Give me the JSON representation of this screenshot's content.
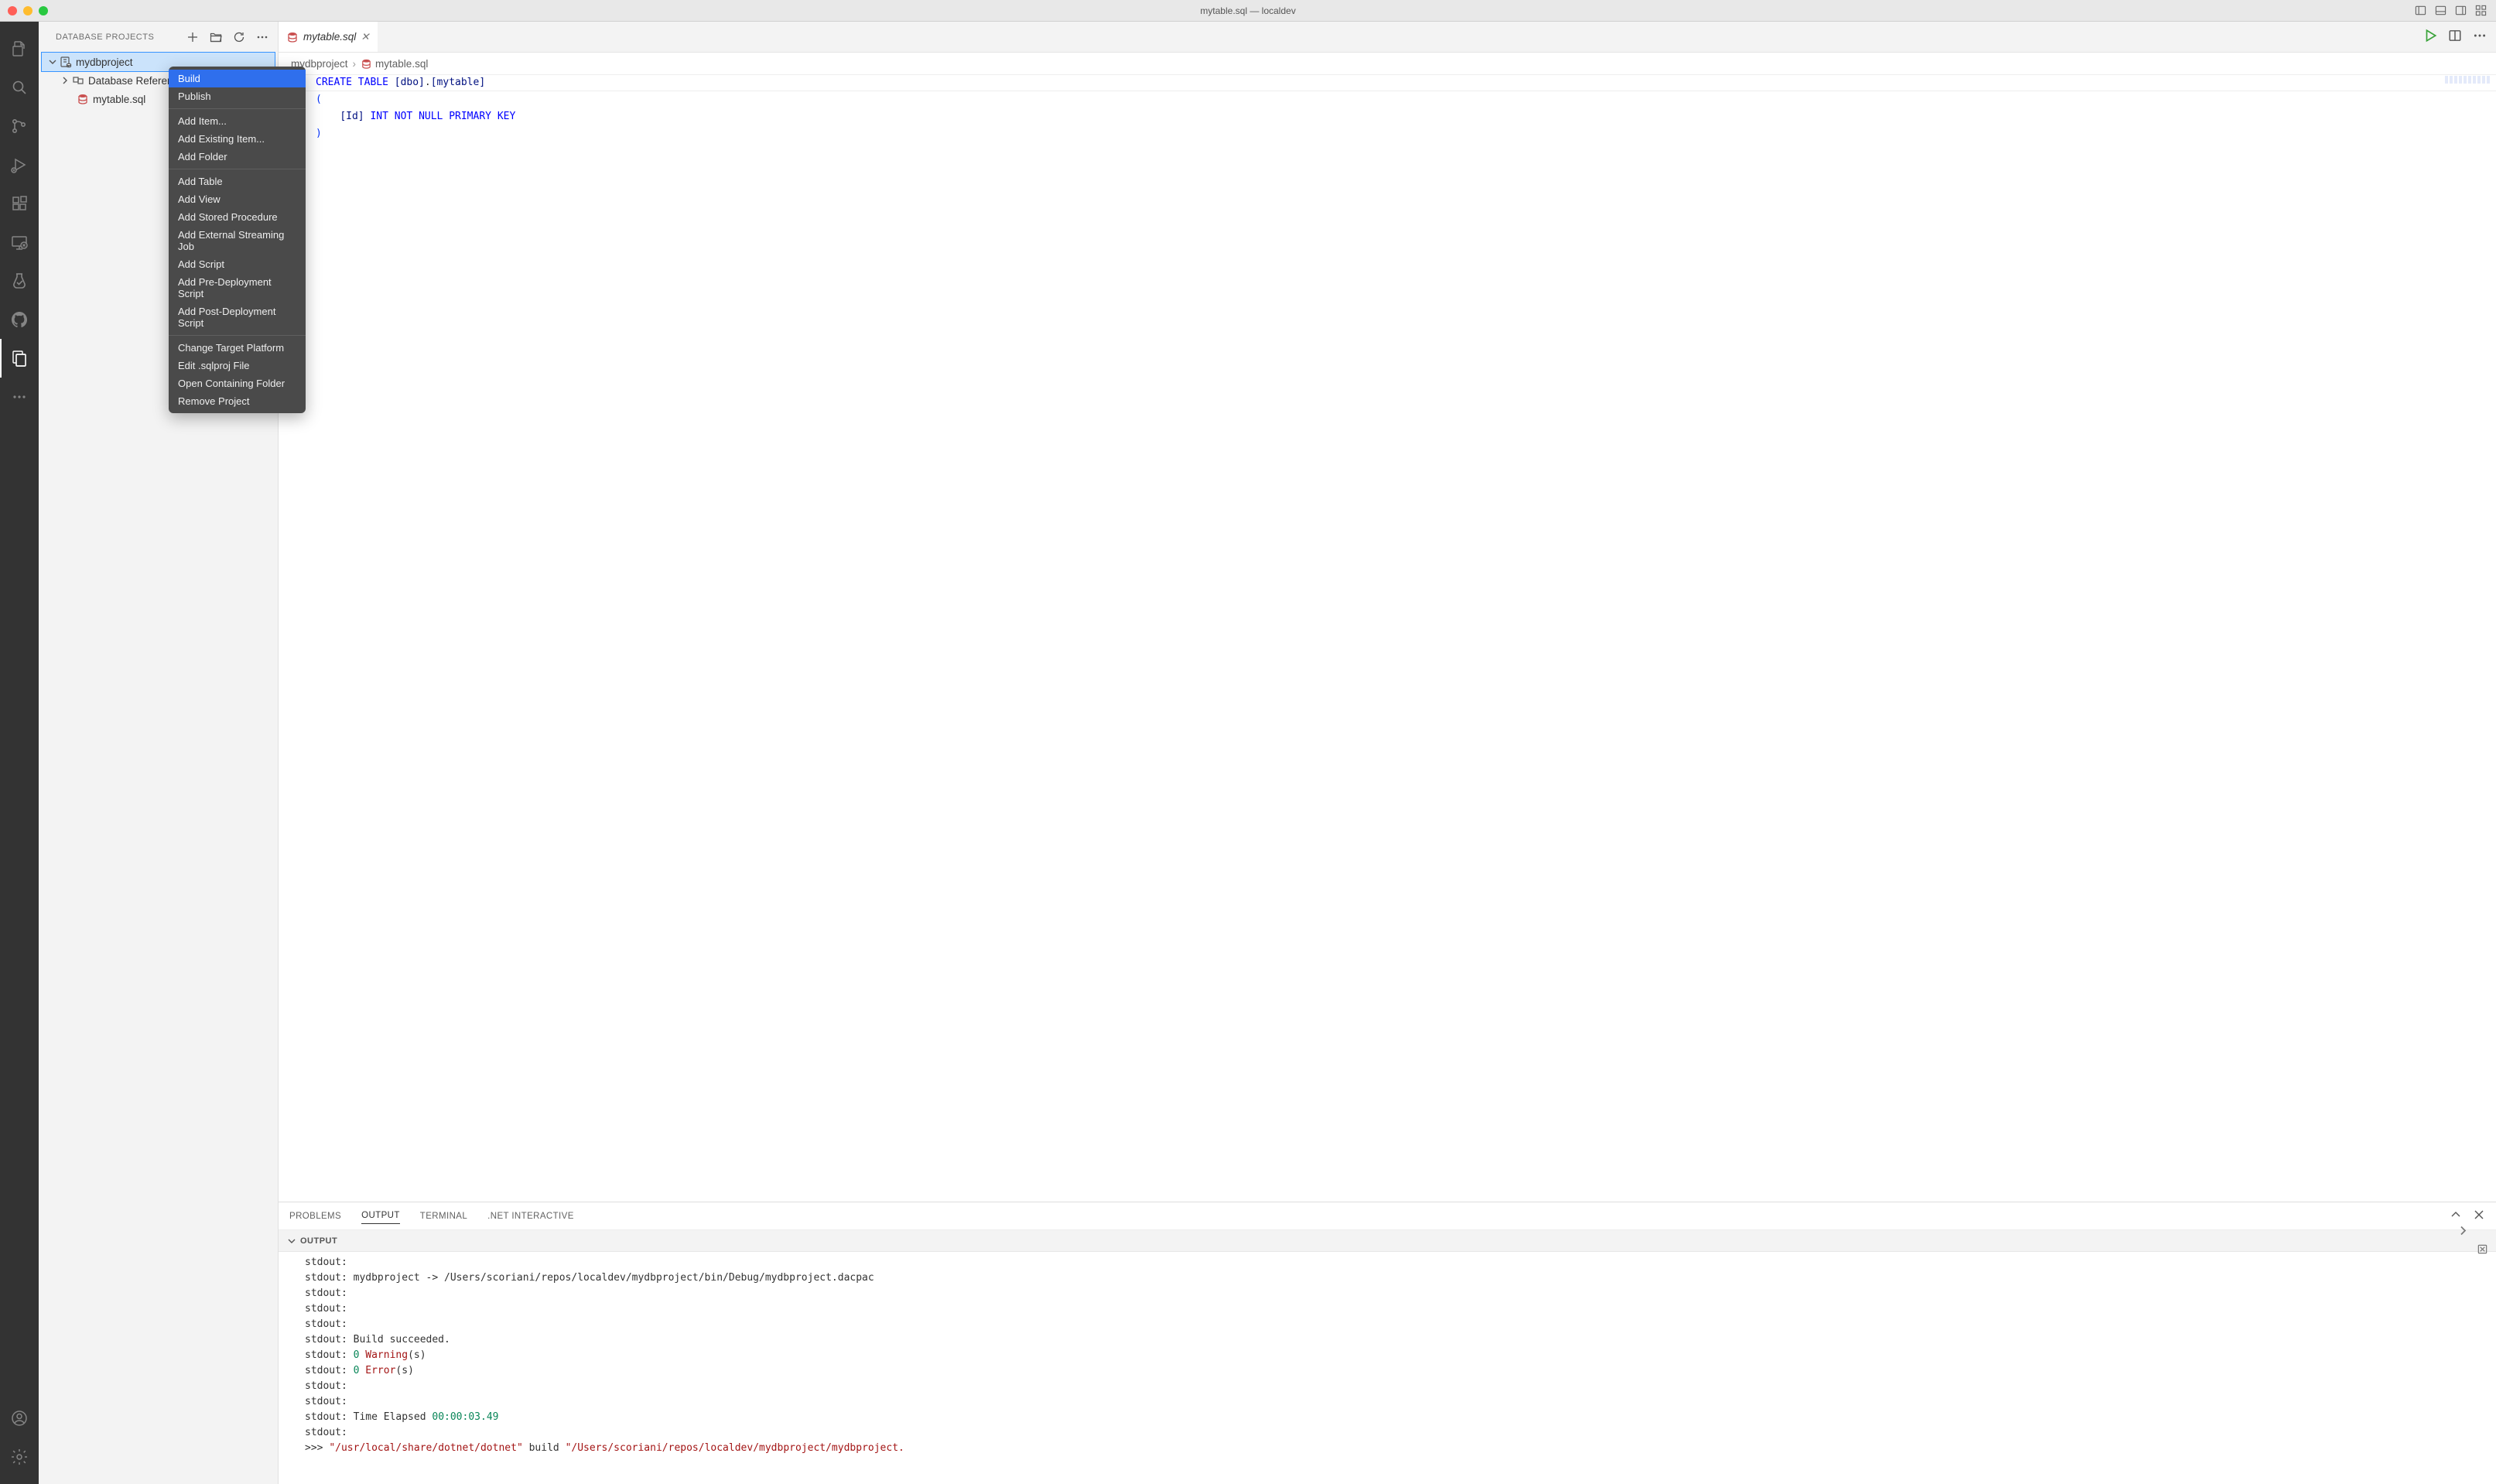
{
  "titlebar": {
    "title": "mytable.sql — localdev"
  },
  "sidebar": {
    "title": "DATABASE PROJECTS",
    "tree": {
      "project": "mydbproject",
      "refs": "Database References",
      "file": "mytable.sql"
    }
  },
  "context_menu": {
    "build": "Build",
    "publish": "Publish",
    "add_item": "Add Item...",
    "add_existing": "Add Existing Item...",
    "add_folder": "Add Folder",
    "add_table": "Add Table",
    "add_view": "Add View",
    "add_sp": "Add Stored Procedure",
    "add_ext_stream": "Add External Streaming Job",
    "add_script": "Add Script",
    "add_pre": "Add Pre-Deployment Script",
    "add_post": "Add Post-Deployment Script",
    "change_target": "Change Target Platform",
    "edit_sqlproj": "Edit .sqlproj File",
    "open_folder": "Open Containing Folder",
    "remove": "Remove Project"
  },
  "tab": {
    "label": "mytable.sql"
  },
  "breadcrumbs": {
    "p0": "mydbproject",
    "p1": "mytable.sql"
  },
  "code": {
    "l1": {
      "a": "CREATE TABLE",
      "b": " [dbo]",
      ".": ".",
      "c": "[mytable]"
    },
    "l2": "(",
    "l3": {
      "indent": "    ",
      "id": "[Id]",
      "sp": " ",
      "type": "INT NOT NULL PRIMARY KEY"
    },
    "l4": ")",
    "l5": ""
  },
  "panel": {
    "tabs": {
      "problems": "PROBLEMS",
      "output": "OUTPUT",
      "terminal": "TERMINAL",
      "dotnet": ".NET INTERACTIVE"
    },
    "section_title": "OUTPUT",
    "output": {
      "l1": "stdout: ",
      "l2a": "stdout:   mydbproject -> /Users/scoriani/repos/localdev/mydbproject/bin/Debug/mydbproject.dacpac",
      "l3": "stdout: ",
      "l4": "stdout: ",
      "l5": "stdout: ",
      "l6": "stdout: Build succeeded.",
      "l7p": "stdout:     ",
      "l7n": "0",
      "l7w": " Warning",
      "l7s": "(s)",
      "l8p": "stdout:     ",
      "l8n": "0",
      "l8w": " Error",
      "l8s": "(s)",
      "l9": "stdout: ",
      "l10": "stdout: ",
      "l11p": "stdout: Time Elapsed ",
      "l11t": "00:00:03.49",
      "l12": "stdout: ",
      "l13a": ">>> ",
      "l13b": "\"/usr/local/share/dotnet/dotnet\"",
      "l13c": "  build ",
      "l13d": "\"/Users/scoriani/repos/localdev/mydbproject/mydbproject."
    }
  }
}
